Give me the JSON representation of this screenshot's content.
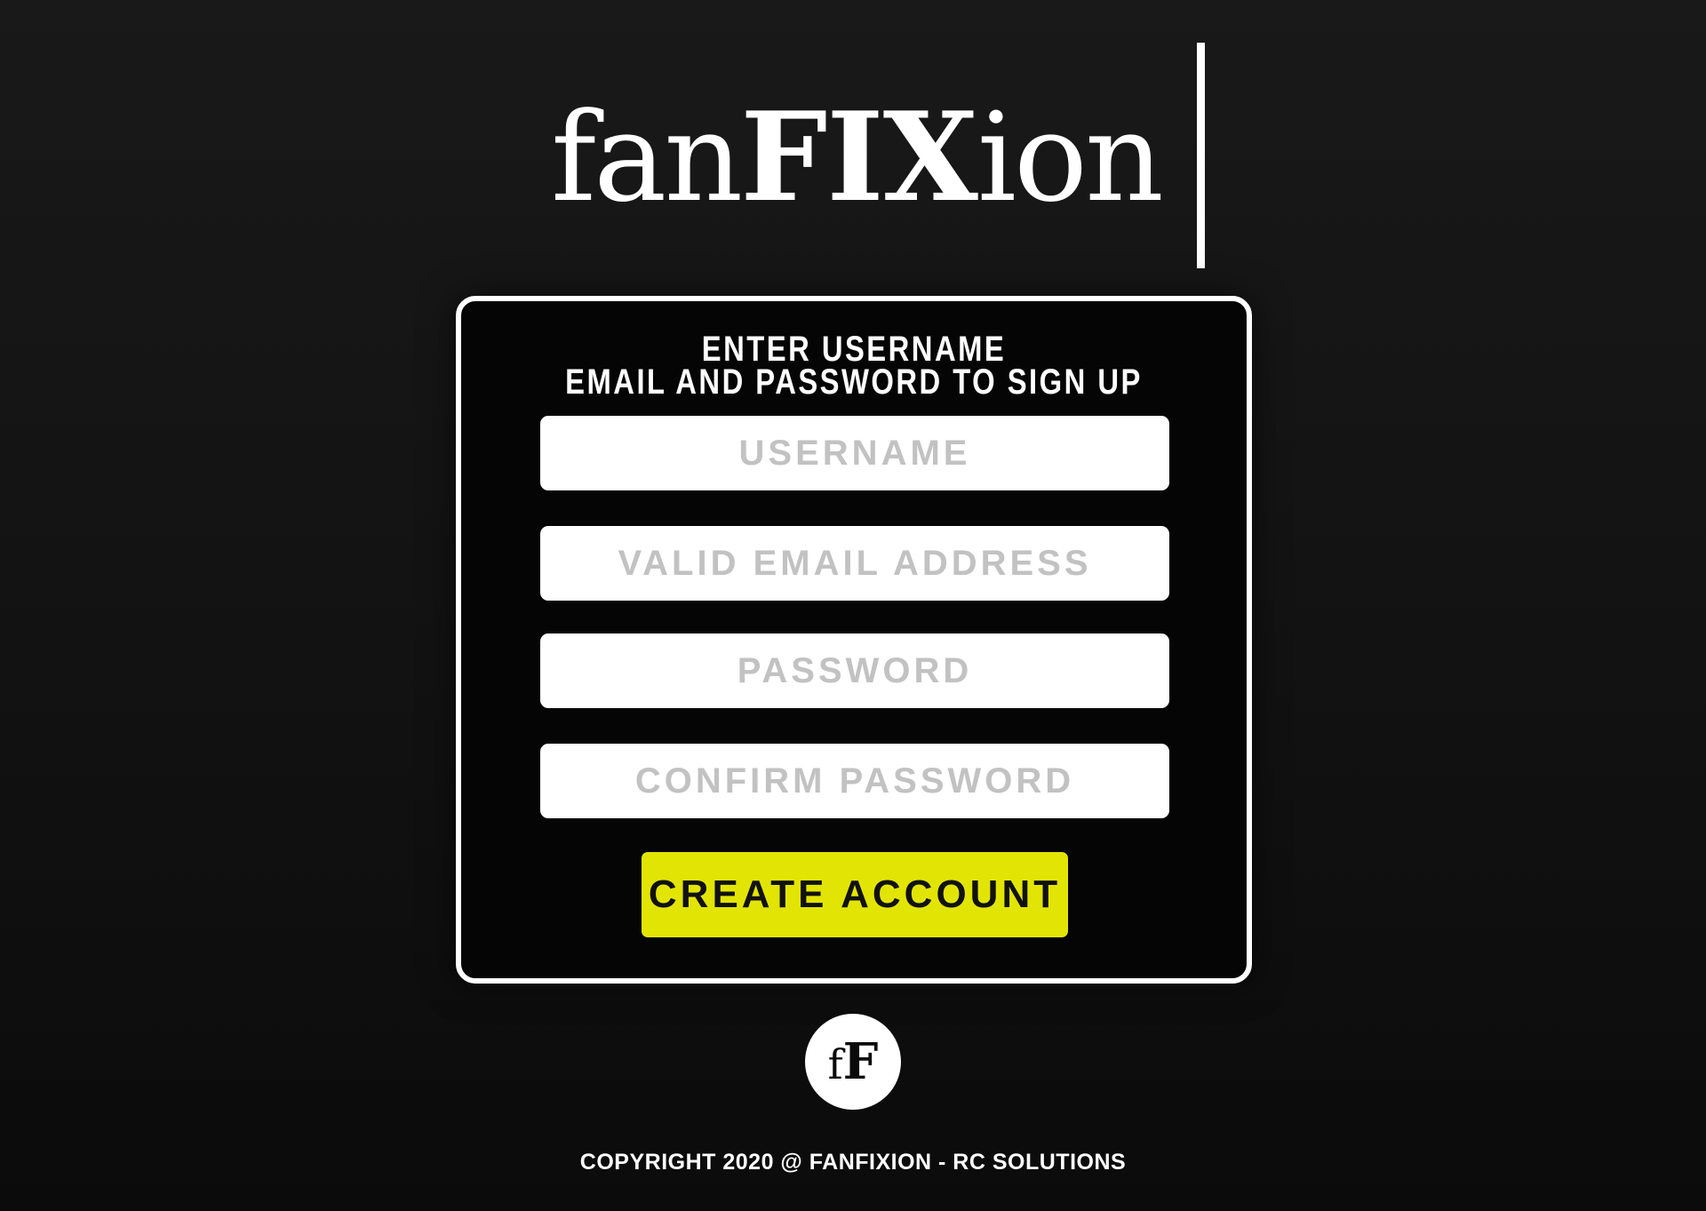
{
  "brand": {
    "logo_light_1": "fan",
    "logo_bold": "FIX",
    "logo_light_2": "ion",
    "badge_small": "f",
    "badge_big": "F"
  },
  "form": {
    "heading_line1": "ENTER USERNAME",
    "heading_line2": "EMAIL AND PASSWORD TO SIGN UP",
    "username_placeholder": "USERNAME",
    "email_placeholder": "VALID EMAIL ADDRESS",
    "password_placeholder": "PASSWORD",
    "confirm_placeholder": "CONFIRM PASSWORD",
    "submit_label": "CREATE ACCOUNT"
  },
  "footer": {
    "copyright": "COPYRIGHT 2020 @ FANFIXION - RC SOLUTIONS"
  },
  "colors": {
    "accent": "#e2e503",
    "background": "#161616",
    "card": "#050505"
  }
}
